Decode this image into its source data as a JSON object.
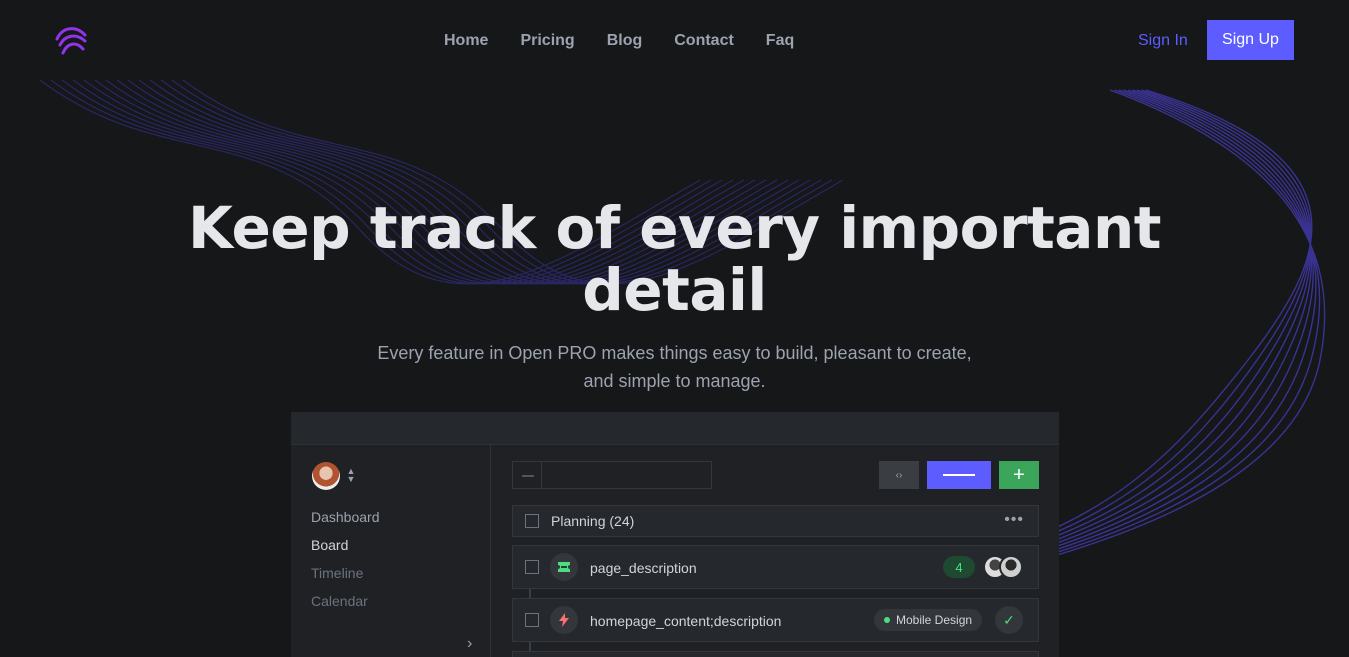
{
  "header": {
    "nav": [
      "Home",
      "Pricing",
      "Blog",
      "Contact",
      "Faq"
    ],
    "signin_label": "Sign In",
    "signup_label": "Sign Up"
  },
  "hero": {
    "title": "Keep track of every important detail",
    "subtitle": "Every feature in Open PRO makes things easy to build, pleasant to create, and simple to manage."
  },
  "app": {
    "sidebar": {
      "items": [
        "Dashboard",
        "Board",
        "Timeline",
        "Calendar"
      ],
      "active": "Board"
    },
    "list_header": "Planning (24)",
    "tasks": [
      {
        "name": "page_description",
        "count": "4",
        "icon": "ticket-icon"
      },
      {
        "name": "homepage_content;description",
        "tag": "Mobile Design",
        "icon": "lightning-icon",
        "status": "done"
      }
    ]
  },
  "colors": {
    "background": "#151719",
    "accent": "#5d5dff",
    "success": "#3ba55c",
    "logo": "#9333ea"
  }
}
